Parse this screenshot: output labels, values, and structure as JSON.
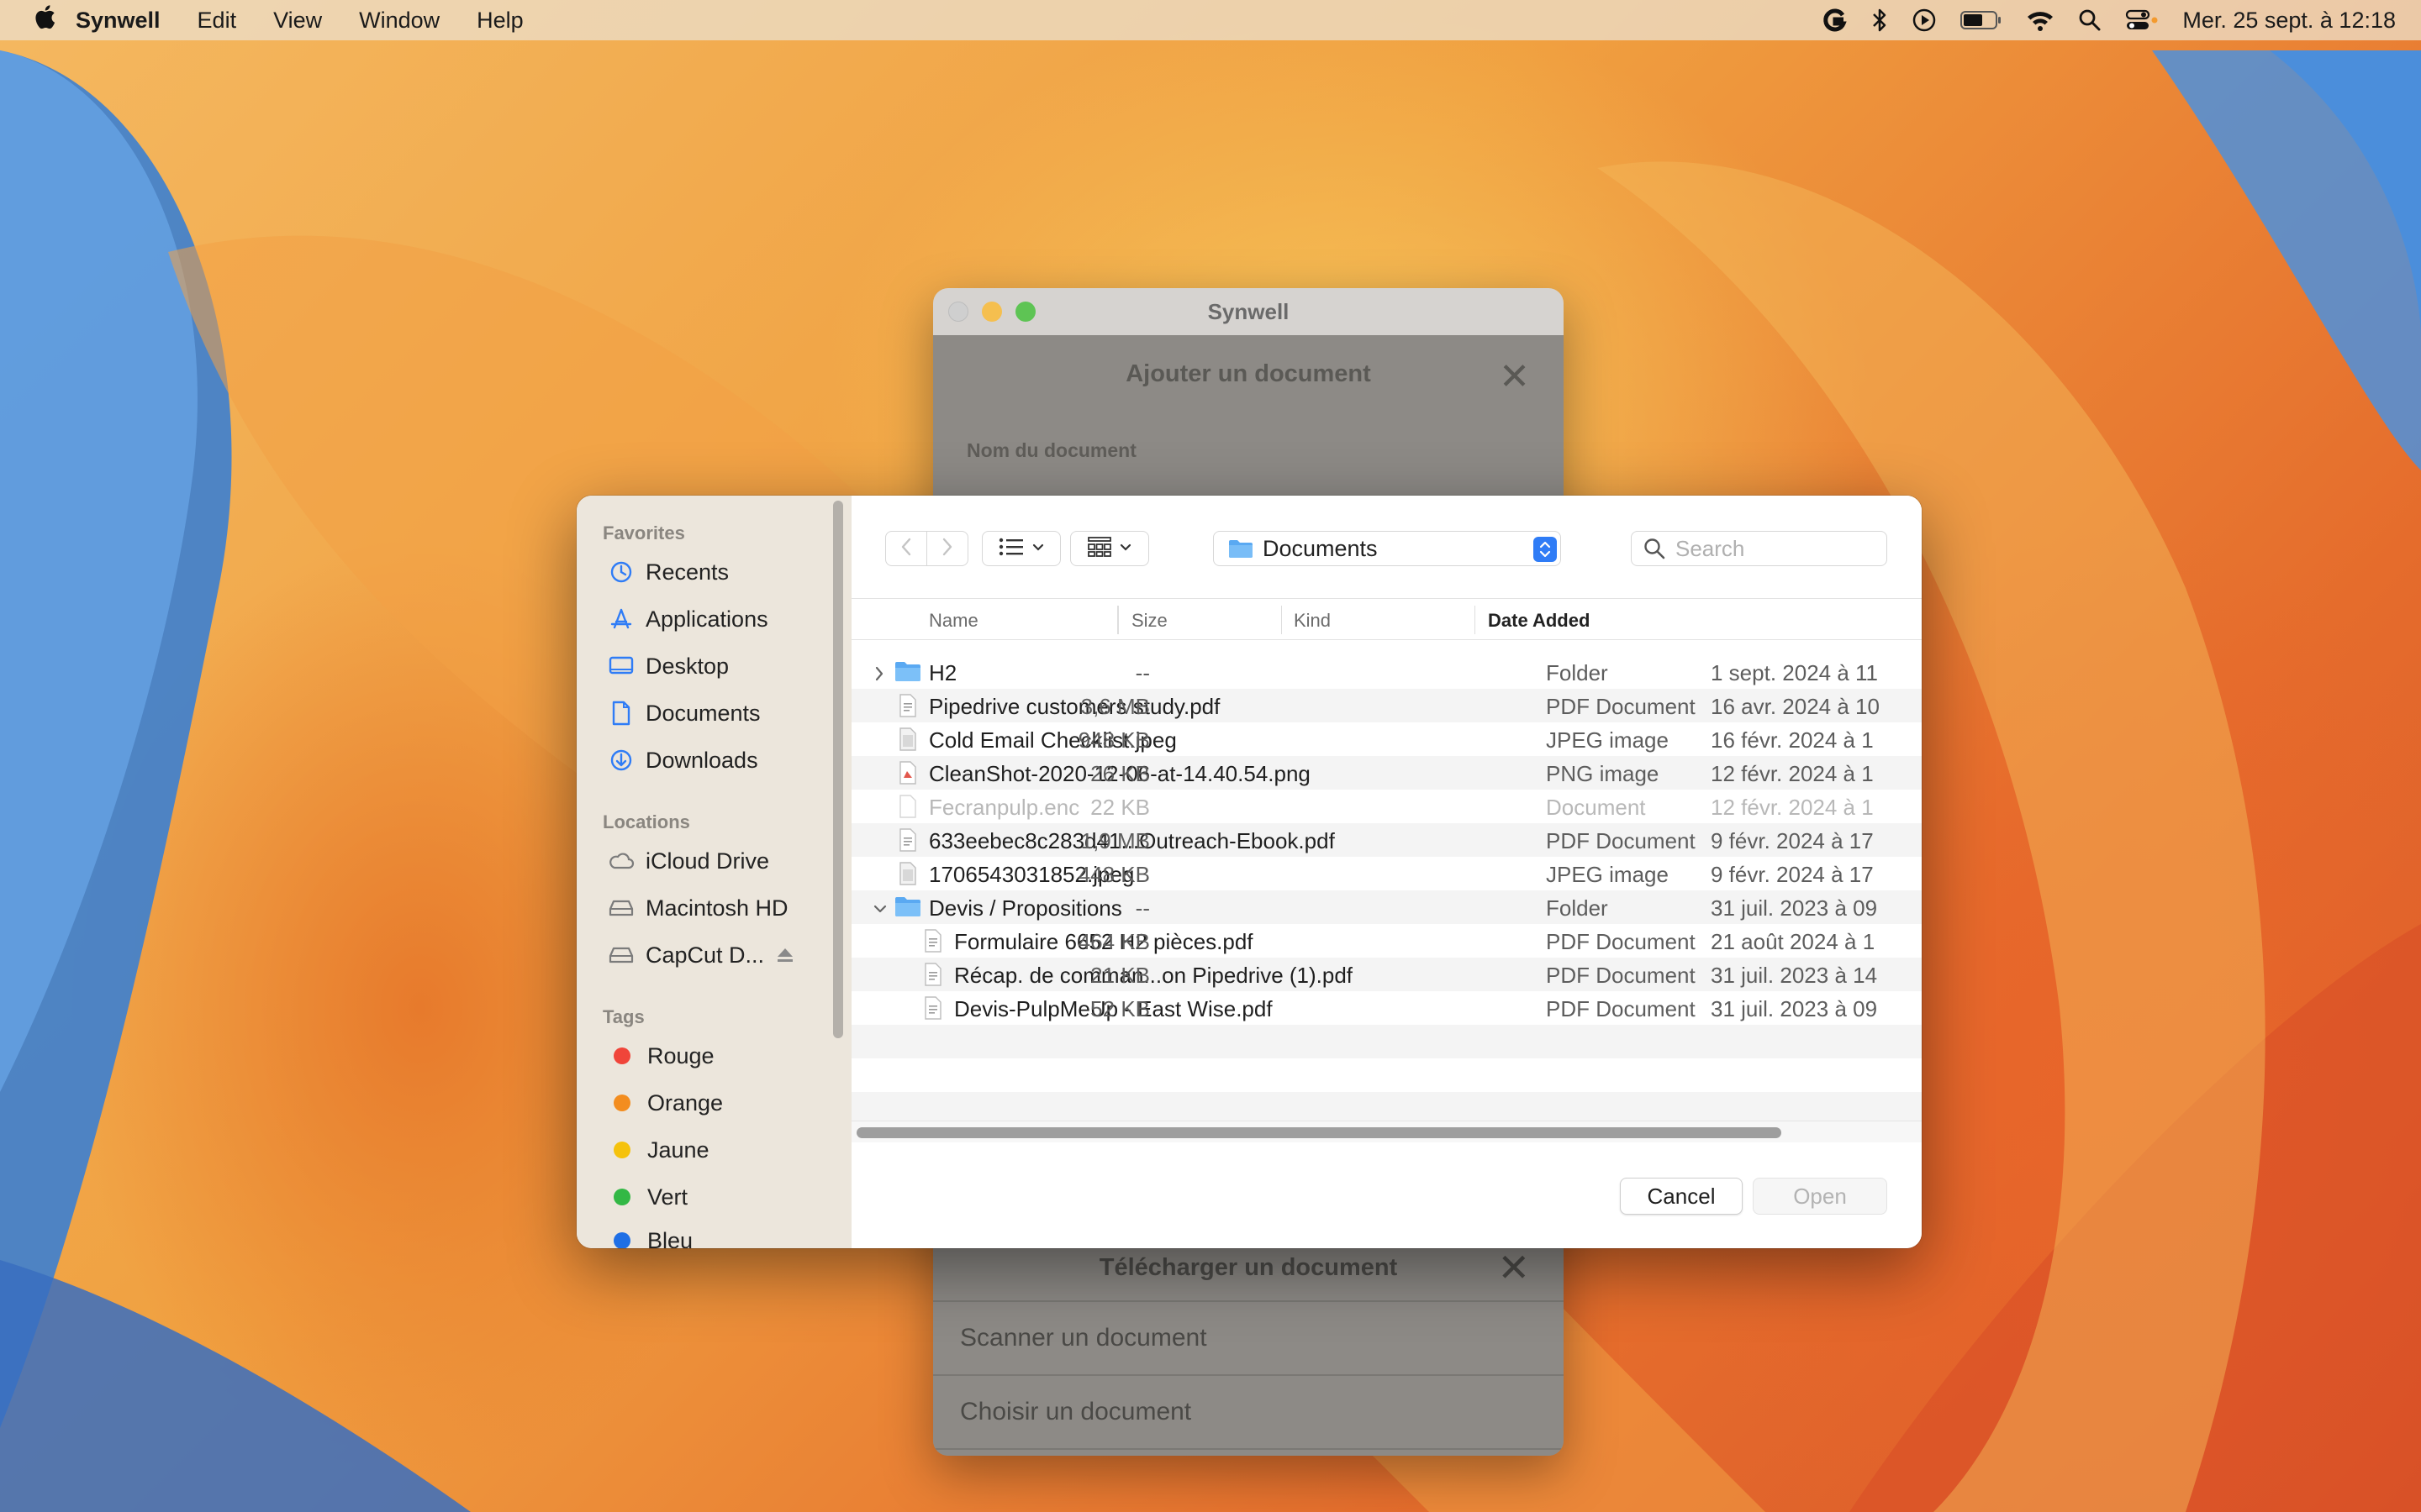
{
  "menubar": {
    "app_name": "Synwell",
    "items": [
      "Edit",
      "View",
      "Window",
      "Help"
    ],
    "clock": "Mer. 25 sept. à 12:18",
    "status_icons": [
      "grammarly-icon",
      "bluetooth-icon",
      "play-circle-icon",
      "battery-icon",
      "wifi-icon",
      "spotlight-search-icon",
      "control-center-icon"
    ]
  },
  "app_window": {
    "title": "Synwell",
    "heading": "Ajouter un document",
    "field_label": "Nom du document",
    "sheet": {
      "title": "Télécharger un document",
      "options": [
        "Scanner un document",
        "Choisir un document"
      ]
    }
  },
  "dialog": {
    "sidebar": {
      "favorites_title": "Favorites",
      "favorites": [
        {
          "label": "Recents",
          "icon": "clock-icon"
        },
        {
          "label": "Applications",
          "icon": "applications-icon"
        },
        {
          "label": "Desktop",
          "icon": "desktop-icon"
        },
        {
          "label": "Documents",
          "icon": "document-icon"
        },
        {
          "label": "Downloads",
          "icon": "download-icon"
        }
      ],
      "locations_title": "Locations",
      "locations": [
        {
          "label": "iCloud Drive",
          "icon": "cloud-icon"
        },
        {
          "label": "Macintosh HD",
          "icon": "drive-icon"
        },
        {
          "label": "CapCut D...",
          "icon": "drive-icon",
          "eject": true
        }
      ],
      "tags_title": "Tags",
      "tags": [
        {
          "label": "Rouge",
          "color": "#f0453a"
        },
        {
          "label": "Orange",
          "color": "#f38d1f"
        },
        {
          "label": "Jaune",
          "color": "#f5c20c"
        },
        {
          "label": "Vert",
          "color": "#33b845"
        },
        {
          "label": "Bleu",
          "color": "#1f6fe5"
        }
      ]
    },
    "toolbar": {
      "location": "Documents",
      "search_placeholder": "Search"
    },
    "columns": {
      "name": "Name",
      "size": "Size",
      "kind": "Kind",
      "date": "Date Added"
    },
    "files": [
      {
        "name": "H2",
        "size": "--",
        "kind": "Folder",
        "date": "1 sept. 2024 à 11",
        "type": "folder",
        "expand": "collapsed",
        "level": 0
      },
      {
        "name": "Pipedrive customers study.pdf",
        "size": "3,6 MB",
        "kind": "PDF Document",
        "date": "16 avr. 2024 à 10",
        "type": "pdf",
        "level": 0
      },
      {
        "name": "Cold Email Checklist.jpeg",
        "size": "948 KB",
        "kind": "JPEG image",
        "date": "16 févr. 2024 à 1",
        "type": "image",
        "level": 0
      },
      {
        "name": "CleanShot-2020-12-06-at-14.40.54.png",
        "size": "26 KB",
        "kind": "PNG image",
        "date": "12 févr. 2024 à 1",
        "type": "png",
        "level": 0
      },
      {
        "name": "Fecranpulp.enc",
        "size": "22 KB",
        "kind": "Document",
        "date": "12 févr. 2024 à 1",
        "type": "doc",
        "level": 0,
        "dim": true
      },
      {
        "name": "633eebec8c283d41...Outreach-Ebook.pdf",
        "size": "1,9 MB",
        "kind": "PDF Document",
        "date": "9 févr. 2024 à 17",
        "type": "pdf",
        "level": 0
      },
      {
        "name": "1706543031852.jpeg",
        "size": "448 KB",
        "kind": "JPEG image",
        "date": "9 févr. 2024 à 17",
        "type": "image",
        "level": 0
      },
      {
        "name": "Devis / Propositions",
        "size": "--",
        "kind": "Folder",
        "date": "31 juil. 2023 à 09",
        "type": "folder",
        "expand": "expanded",
        "level": 0
      },
      {
        "name": "Formulaire 6652 H2 pièces.pdf",
        "size": "464 KB",
        "kind": "PDF Document",
        "date": "21 août 2024 à 1",
        "type": "pdf",
        "level": 1
      },
      {
        "name": "Récap. de comman...on Pipedrive (1).pdf",
        "size": "21 KB",
        "kind": "PDF Document",
        "date": "31 juil. 2023 à 14",
        "type": "pdf",
        "level": 1
      },
      {
        "name": "Devis-PulpMeUp - East Wise.pdf",
        "size": "52 KB",
        "kind": "PDF Document",
        "date": "31 juil. 2023 à 09",
        "type": "pdf",
        "level": 1
      }
    ],
    "buttons": {
      "cancel": "Cancel",
      "open": "Open"
    }
  }
}
